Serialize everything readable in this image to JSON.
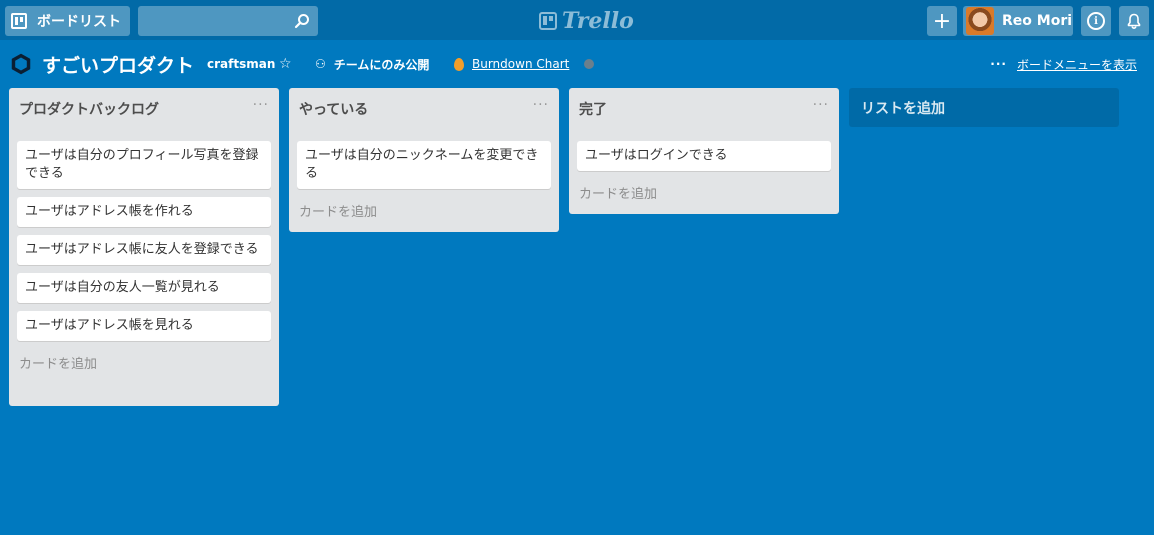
{
  "header": {
    "boards_label": "ボードリスト",
    "search_placeholder": "",
    "logo_text": "Trello",
    "add_label": "+",
    "user_name": "Reo Mori",
    "info_label": "i"
  },
  "board": {
    "title": "すごいプロダクト",
    "team": "craftsman",
    "visibility": "チームにのみ公開",
    "burndown": "Burndown Chart",
    "menu_label": "ボードメニューを表示",
    "menu_dots": "···"
  },
  "lists": [
    {
      "title": "プロダクトバックログ",
      "menu": "···",
      "cards": [
        "ユーザは自分のプロフィール写真を登録できる",
        "ユーザはアドレス帳を作れる",
        "ユーザはアドレス帳に友人を登録できる",
        "ユーザは自分の友人一覧が見れる",
        "ユーザはアドレス帳を見れる"
      ],
      "add_card": "カードを追加"
    },
    {
      "title": "やっている",
      "menu": "···",
      "cards": [
        "ユーザは自分のニックネームを変更できる"
      ],
      "add_card": "カードを追加"
    },
    {
      "title": "完了",
      "menu": "···",
      "cards": [
        "ユーザはログインできる"
      ],
      "add_card": "カードを追加"
    }
  ],
  "add_list": "リストを追加",
  "colors": {
    "board_bg": "#0079bf",
    "header_bg": "#026aa7",
    "list_bg": "#e2e4e6",
    "card_bg": "#ffffff"
  }
}
